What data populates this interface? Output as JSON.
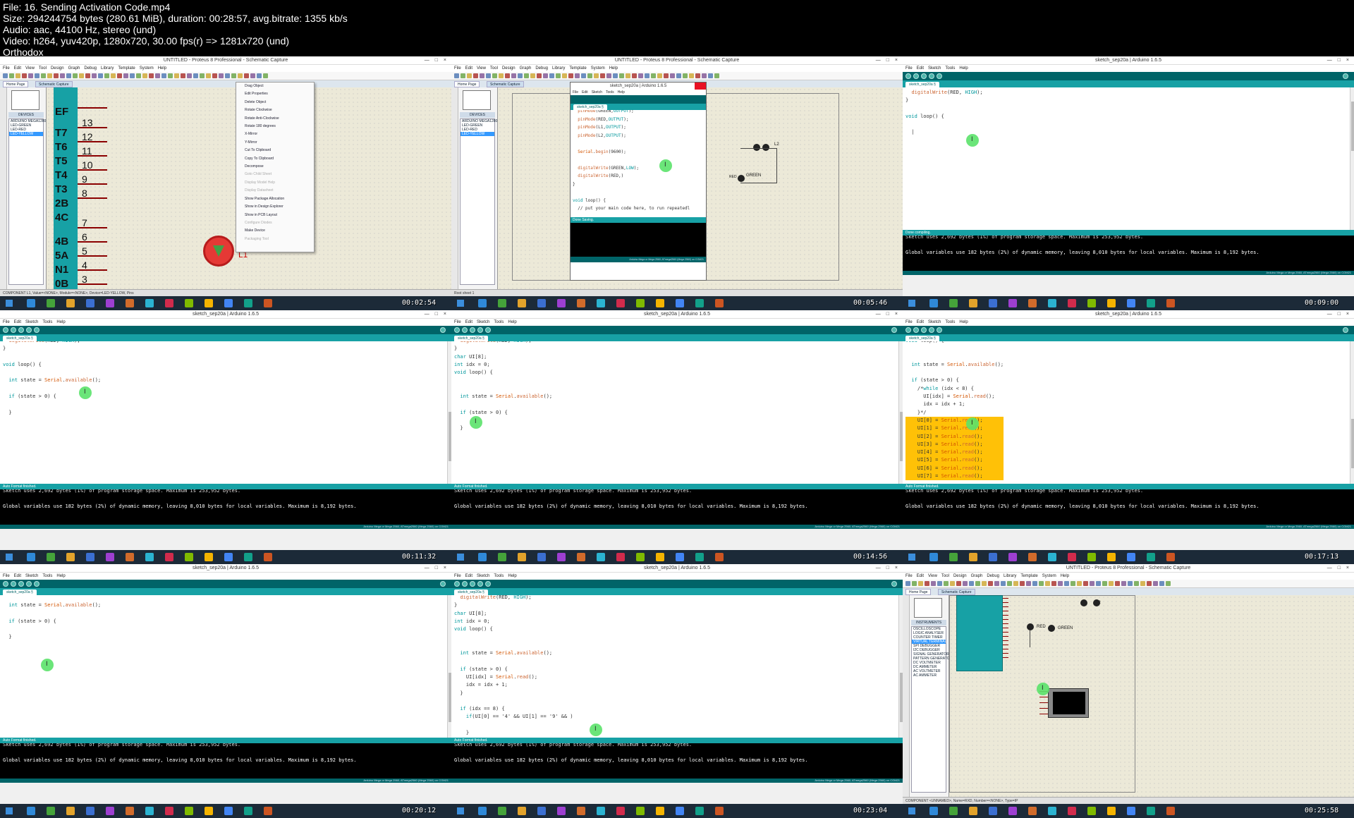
{
  "header": {
    "file": "File: 16. Sending Activation Code.mp4",
    "size": "Size: 294244754 bytes (280.61 MiB), duration: 00:28:57, avg.bitrate: 1355 kb/s",
    "audio": "Audio: aac, 44100 Hz, stereo (und)",
    "video": "Video: h264, yuv420p, 1280x720, 30.00 fps(r) => 1281x720 (und)",
    "watermark": "Orthodox"
  },
  "proteus_title": "UNTITLED - Proteus 8 Professional - Schematic Capture",
  "arduino_title": "sketch_sep20a | Arduino 1.6.5",
  "arduino_tab": "sketch_sep20a §",
  "proteus_menu": [
    "File",
    "Edit",
    "View",
    "Tool",
    "Design",
    "Graph",
    "Debug",
    "Library",
    "Template",
    "System",
    "Help"
  ],
  "arduino_menu": [
    "File",
    "Edit",
    "Sketch",
    "Tools",
    "Help"
  ],
  "proteus_tabs": {
    "home": "Home Page",
    "schematic": "Schematic Capture"
  },
  "devices_label": "DEVICES",
  "instruments_label": "INSTRUMENTS",
  "devices": [
    "ARDUINO MEGA1280",
    "LED-GREEN",
    "LED-RED",
    "LED-YELLOW"
  ],
  "instruments": [
    "OSCILLOSCOPE",
    "LOGIC ANALYSER",
    "COUNTER TIMER",
    "VIRTUAL TERMINAL",
    "SPI DEBUGGER",
    "I2C DEBUGGER",
    "SIGNAL GENERATOR",
    "PATTERN GENERATOR",
    "DC VOLTMETER",
    "DC AMMETER",
    "AC VOLTMETER",
    "AC AMMETER"
  ],
  "context_menu": [
    "Drag Object",
    "Edit Properties",
    "Delete Object",
    "Rotate Clockwise",
    "Rotate Anti-Clockwise",
    "Rotate 180 degrees",
    "X-Mirror",
    "Y-Mirror",
    "Cut To Clipboard",
    "Copy To Clipboard",
    "Decompose",
    "Goto Child Sheet",
    "Display Model Help",
    "Display Datasheet",
    "Show Package Allocation",
    "Show in Design Explorer",
    "Show in PCB Layout",
    "Configure Diodes",
    "Make Device",
    "Packaging Tool"
  ],
  "pin_labels": [
    "EF",
    "T7",
    "T6",
    "T5",
    "T4",
    "T3",
    "2B",
    "4C",
    "4B",
    "5A",
    "N1",
    "0B"
  ],
  "pin_numbers": [
    "13",
    "12",
    "11",
    "10",
    "9",
    "8",
    "7",
    "6",
    "5",
    "4",
    "3"
  ],
  "component_label": "L1",
  "led_labels": {
    "red": "RED",
    "green": "GREEN",
    "l1": "L1",
    "l2": "L2"
  },
  "status_bar_1": "COMPONENT L1, Value=<NONE>, Module=<NONE>, Device=LED-YELLOW, Pins",
  "status_bar_2": "Root sheet 1",
  "status_bar_9": "COMPONENT <UNNAMED>, Name=RXD, Number=<NONE>, Type=IP",
  "done_compiling": "Done compiling.",
  "done_saving": "Done Saving.",
  "auto_format": "Auto Format finished.",
  "console_line1": "Sketch uses 2,692 bytes (1%) of program storage space. Maximum is 253,952 bytes.",
  "console_line2": "Global variables use 182 bytes (2%) of dynamic memory, leaving 8,010 bytes for local variables. Maximum is 8,192 bytes.",
  "board_info": "Arduino Mega or Mega 2560, ATmega2560 (Mega 2560) on COM21",
  "timestamps": [
    "00:02:54",
    "00:05:46",
    "00:09:00",
    "00:11:32",
    "00:14:56",
    "00:17:13",
    "00:20:12",
    "00:23:04",
    "00:25:58"
  ],
  "code": {
    "c2": [
      "  pinMode(GREEN,OUTPUT);",
      "  pinMode(RED,OUTPUT);",
      "  pinMode(L1,OUTPUT);",
      "  pinMode(L2,OUTPUT);",
      "",
      "  Serial.begin(9600);",
      "",
      "  digitalWrite(GREEN,LOW);",
      "  digitalWrite(RED,)",
      "}",
      "",
      "void loop() {",
      "  // put your main code here, to run repeatedl"
    ],
    "c3": [
      "  digitalWrite(RED, HIGH);",
      "}",
      "",
      "void loop() {",
      "",
      "  |"
    ],
    "c4": [
      "  digitalWrite(RED, HIGH);",
      "}",
      "",
      "void loop() {",
      "",
      "  int state = Serial.available();",
      "",
      "  if (state > 0) {",
      "",
      "  }"
    ],
    "c5": [
      "  digitalWrite(RED, HIGH);",
      "}",
      "char UI[8];",
      "int idx = 0;",
      "void loop() {",
      "",
      "",
      "  int state = Serial.available();",
      "",
      "  if (state > 0) {",
      "",
      "  }"
    ],
    "c6": [
      "void loop() {",
      "",
      "",
      "  int state = Serial.available();",
      "",
      "  if (state > 0) {",
      "    /*while (idx < 8) {",
      "      UI[idx] = Serial.read();",
      "      idx = idx + 1;",
      "    }*/",
      "    UI[0] = Serial.read();",
      "    UI[1] = Serial.read();",
      "    UI[2] = Serial.read();",
      "    UI[3] = Serial.read();",
      "    UI[4] = Serial.read();",
      "    UI[5] = Serial.read();",
      "    UI[6] = Serial.read();",
      "    UI[7] = Serial.read();"
    ],
    "c7": [
      "",
      "  int state = Serial.available();",
      "",
      "  if (state > 0) {",
      "",
      "  }"
    ],
    "c8": [
      "  digitalWrite(RED, HIGH);",
      "}",
      "char UI[8];",
      "int idx = 0;",
      "void loop() {",
      "",
      "",
      "  int state = Serial.available();",
      "",
      "  if (state > 0) {",
      "    UI[idx] = Serial.read();",
      "    idx = idx + 1;",
      "  }",
      "",
      "  if (idx == 8) {",
      "    if(UI[0] == '4' && UI[1] == '9' && )",
      "",
      "    }"
    ]
  },
  "colors": {
    "arduino_teal": "#006468",
    "arduino_tab": "#17a1a5",
    "highlight": "#ffc107",
    "cursor": "#5be36b"
  }
}
